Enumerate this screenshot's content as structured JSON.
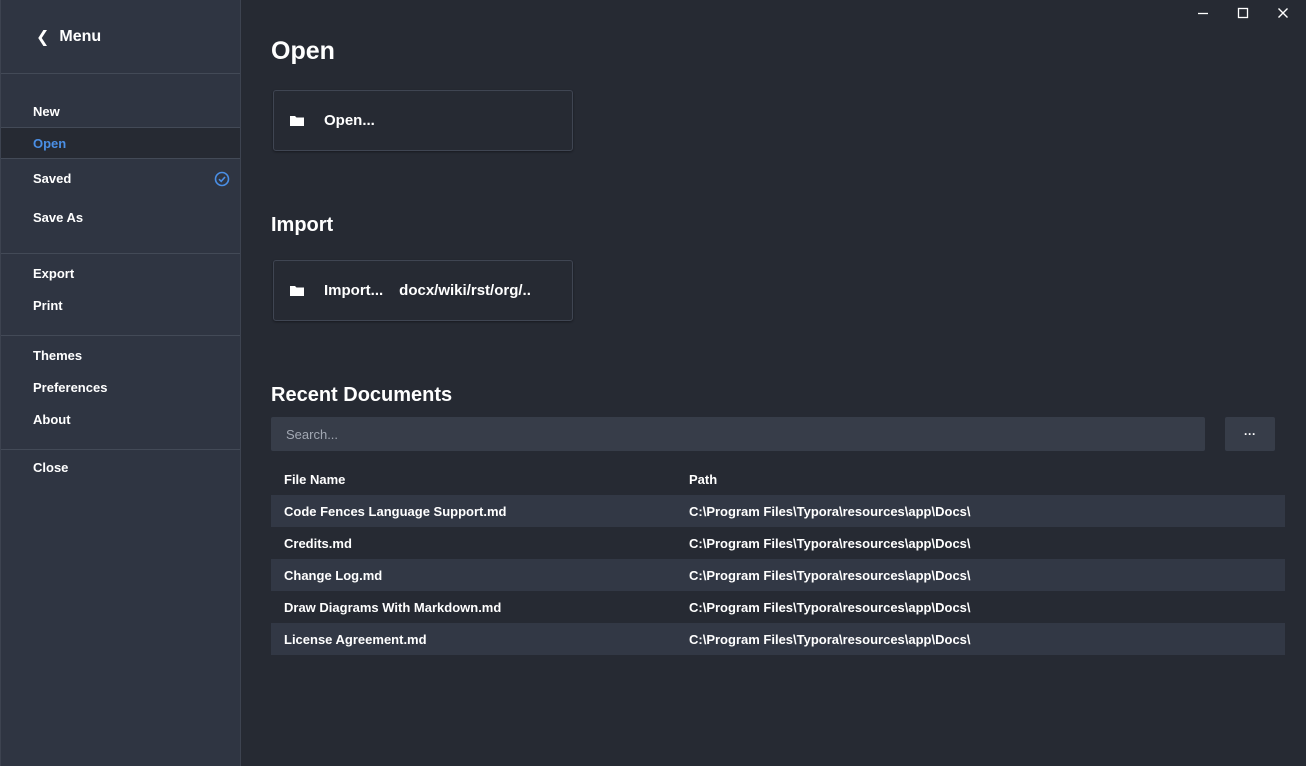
{
  "sidebar": {
    "back_icon": "chevron-left-icon",
    "title": "Menu",
    "items": [
      {
        "label": "New"
      },
      {
        "label": "Open"
      },
      {
        "label": "Saved"
      },
      {
        "label": "Save As"
      },
      {
        "label": "Export"
      },
      {
        "label": "Print"
      },
      {
        "label": "Themes"
      },
      {
        "label": "Preferences"
      },
      {
        "label": "About"
      },
      {
        "label": "Close"
      }
    ],
    "active_color": "#4a8fe6"
  },
  "window_controls": {
    "minimize_icon": "minimize-icon",
    "maximize_icon": "maximize-icon",
    "close_icon": "close-icon"
  },
  "main": {
    "open_title": "Open",
    "open_button_label": "Open...",
    "import_title": "Import",
    "import_button_label": "Import...",
    "import_button_formats": "docx/wiki/rst/org/..",
    "recent_title": "Recent Documents",
    "search_placeholder": "Search...",
    "more_button_label": "···",
    "table": {
      "columns": [
        "File Name",
        "Path"
      ],
      "rows": [
        {
          "name": "Code Fences Language Support.md",
          "path": "C:\\Program Files\\Typora\\resources\\app\\Docs\\"
        },
        {
          "name": "Credits.md",
          "path": "C:\\Program Files\\Typora\\resources\\app\\Docs\\"
        },
        {
          "name": "Change Log.md",
          "path": "C:\\Program Files\\Typora\\resources\\app\\Docs\\"
        },
        {
          "name": "Draw Diagrams With Markdown.md",
          "path": "C:\\Program Files\\Typora\\resources\\app\\Docs\\"
        },
        {
          "name": "License Agreement.md",
          "path": "C:\\Program Files\\Typora\\resources\\app\\Docs\\"
        }
      ]
    }
  }
}
